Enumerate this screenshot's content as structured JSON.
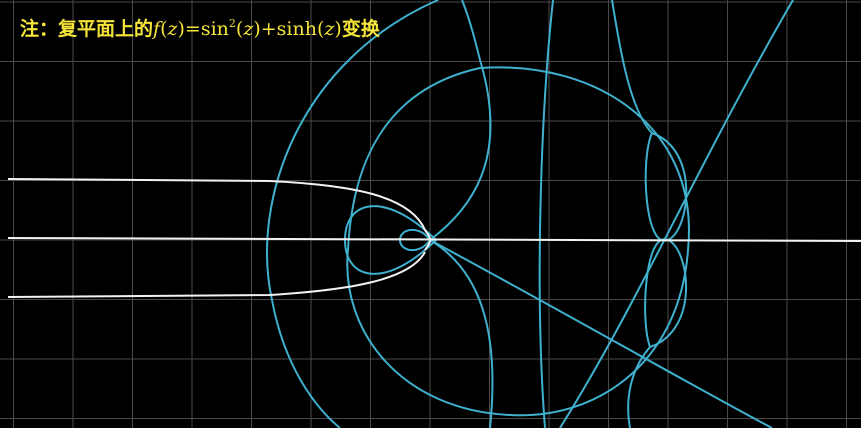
{
  "caption": {
    "prefix": "注：复平面上的",
    "formula": {
      "f": "f",
      "open1": "(",
      "z1": "z",
      "close1": ")=sin",
      "exp": "2",
      "open2": "(",
      "z2": "z",
      "close2": ")+sinh(",
      "z3": "z",
      "close3": ")"
    },
    "suffix": "变换"
  },
  "colors": {
    "background": "#000000",
    "grid": "#4a4a4a",
    "original_curves": "#f2f2f2",
    "transformed_curves": "#3fb1cf",
    "caption": "#f5e43a"
  }
}
